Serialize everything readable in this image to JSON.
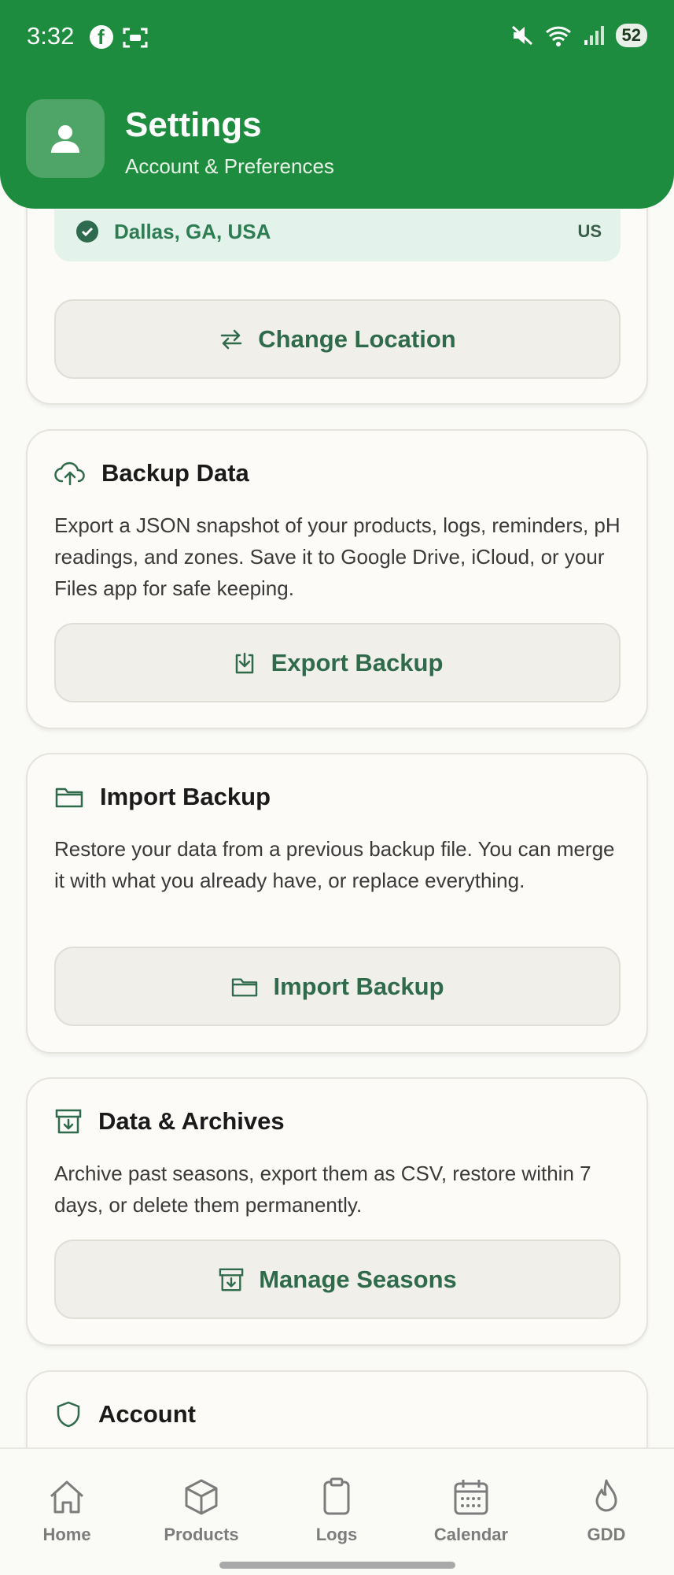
{
  "status": {
    "time": "3:32",
    "battery": "52"
  },
  "header": {
    "title": "Settings",
    "subtitle": "Account & Preferences"
  },
  "location": {
    "name": "Dallas, GA, USA",
    "code": "US",
    "change_label": "Change Location"
  },
  "backup": {
    "title": "Backup Data",
    "desc": "Export a JSON snapshot of your products, logs, reminders, pH readings, and zones. Save it to Google Drive, iCloud, or your Files app for safe keeping.",
    "button": "Export Backup"
  },
  "import": {
    "title": "Import Backup",
    "desc": "Restore your data from a previous backup file. You can merge it with what you already have, or replace everything.",
    "button": "Import Backup"
  },
  "archives": {
    "title": "Data & Archives",
    "desc": "Archive past seasons, export them as CSV, restore within 7 days, or delete them permanently.",
    "button": "Manage Seasons"
  },
  "account": {
    "title": "Account"
  },
  "nav": [
    {
      "label": "Home",
      "icon": "home-icon"
    },
    {
      "label": "Products",
      "icon": "box-icon"
    },
    {
      "label": "Logs",
      "icon": "clipboard-icon"
    },
    {
      "label": "Calendar",
      "icon": "calendar-icon"
    },
    {
      "label": "GDD",
      "icon": "flame-icon"
    }
  ],
  "colors": {
    "brand": "#1e8c3e",
    "accent": "#2f6b4a"
  }
}
